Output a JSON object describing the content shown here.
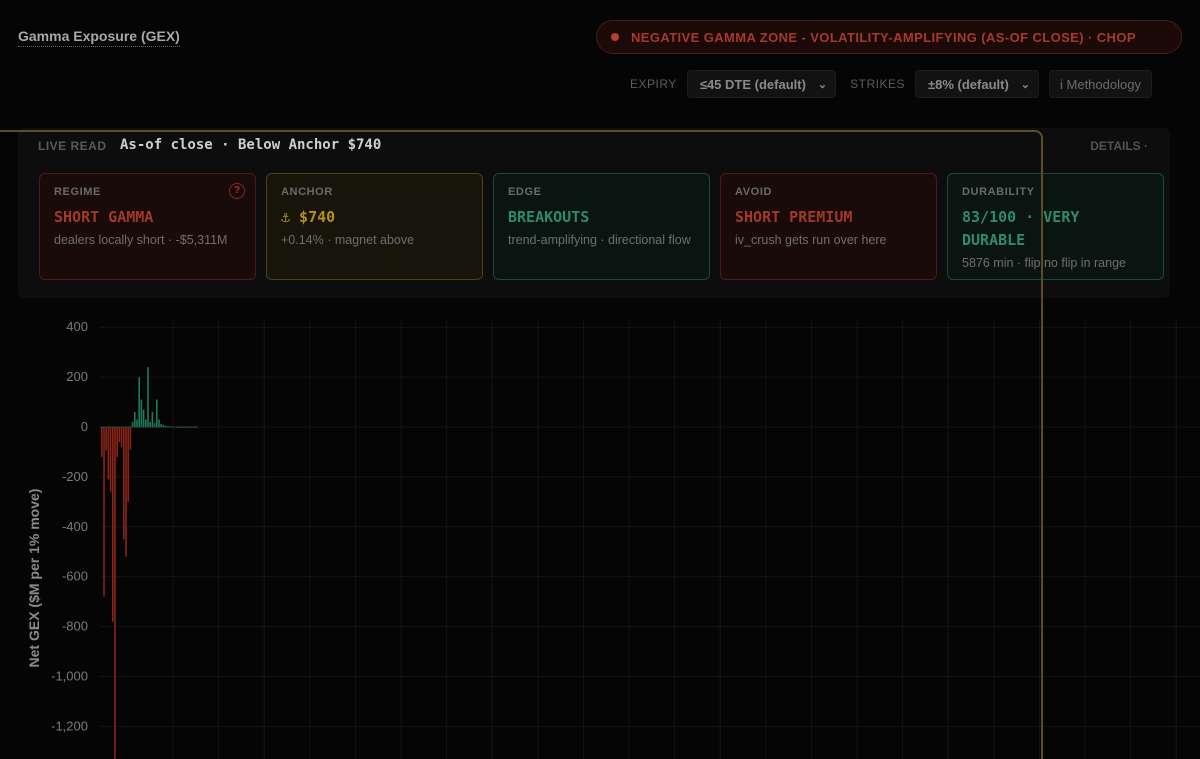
{
  "header": {
    "title": "Gamma Exposure (GEX)",
    "regime_banner": "NEGATIVE GAMMA ZONE - VOLATILITY-AMPLIFYING (AS-OF CLOSE) · CHOP"
  },
  "controls": {
    "expiry_label": "EXPIRY",
    "expiry_value": "≤45 DTE (default)",
    "strikes_label": "STRIKES",
    "strikes_value": "±8% (default)",
    "methodology": "i Methodology"
  },
  "live_read": {
    "label": "LIVE READ",
    "value": "As-of close · Below Anchor $740",
    "details": "DETAILS ·",
    "cards": [
      {
        "label": "REGIME",
        "value": "SHORT GAMMA",
        "sub": "dealers locally short · -$5,311M",
        "tone": "red",
        "help": "?"
      },
      {
        "label": "ANCHOR",
        "value": "⚓ $740",
        "sub": "+0.14% · magnet above",
        "tone": "gold"
      },
      {
        "label": "EDGE",
        "value": "BREAKOUTS",
        "sub": "trend-amplifying · directional flow",
        "tone": "green"
      },
      {
        "label": "AVOID",
        "value": "SHORT PREMIUM",
        "sub": "iv_crush gets run over here",
        "tone": "red"
      },
      {
        "label": "DURABILITY",
        "value": "83/100 · VERY DURABLE",
        "sub": "5876 min · flip no flip in range",
        "tone": "green"
      }
    ]
  },
  "chart_data": {
    "type": "bar",
    "ylabel": "Net GEX ($M per 1% move)",
    "y_ticks": [
      "400",
      "200",
      "0",
      "-200",
      "-400",
      "-600",
      "-800",
      "-1,000",
      "-1,200"
    ],
    "ylim": [
      -1330,
      400
    ],
    "colors": {
      "positive": "#1e7a58",
      "negative": "#8a2418"
    },
    "values": [
      -120,
      -680,
      -95,
      -210,
      -260,
      -780,
      -1330,
      -120,
      -60,
      -80,
      -450,
      -520,
      -300,
      -90,
      20,
      60,
      30,
      200,
      110,
      70,
      30,
      240,
      20,
      60,
      15,
      110,
      30,
      12,
      8,
      5,
      4,
      3,
      2,
      2,
      1,
      1,
      1,
      1,
      1,
      1,
      1,
      1,
      1,
      1
    ]
  },
  "colors": {
    "background": "#050505",
    "accent_red": "#a53a2c",
    "accent_gold": "#b58f1c",
    "accent_green": "#2e8a6a"
  }
}
